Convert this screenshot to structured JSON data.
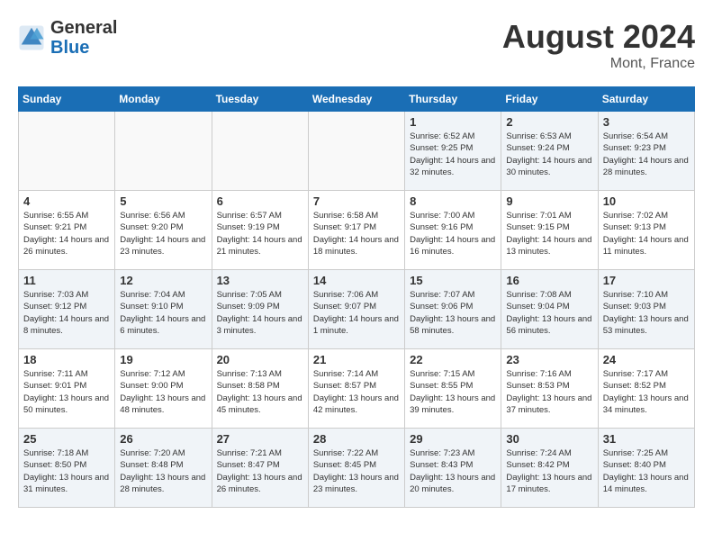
{
  "header": {
    "logo_line1": "General",
    "logo_line2": "Blue",
    "month_year": "August 2024",
    "location": "Mont, France"
  },
  "days_of_week": [
    "Sunday",
    "Monday",
    "Tuesday",
    "Wednesday",
    "Thursday",
    "Friday",
    "Saturday"
  ],
  "weeks": [
    [
      {
        "day": "",
        "empty": true
      },
      {
        "day": "",
        "empty": true
      },
      {
        "day": "",
        "empty": true
      },
      {
        "day": "",
        "empty": true
      },
      {
        "day": "1",
        "sunrise": "6:52 AM",
        "sunset": "9:25 PM",
        "daylight": "14 hours and 32 minutes."
      },
      {
        "day": "2",
        "sunrise": "6:53 AM",
        "sunset": "9:24 PM",
        "daylight": "14 hours and 30 minutes."
      },
      {
        "day": "3",
        "sunrise": "6:54 AM",
        "sunset": "9:23 PM",
        "daylight": "14 hours and 28 minutes."
      }
    ],
    [
      {
        "day": "4",
        "sunrise": "6:55 AM",
        "sunset": "9:21 PM",
        "daylight": "14 hours and 26 minutes."
      },
      {
        "day": "5",
        "sunrise": "6:56 AM",
        "sunset": "9:20 PM",
        "daylight": "14 hours and 23 minutes."
      },
      {
        "day": "6",
        "sunrise": "6:57 AM",
        "sunset": "9:19 PM",
        "daylight": "14 hours and 21 minutes."
      },
      {
        "day": "7",
        "sunrise": "6:58 AM",
        "sunset": "9:17 PM",
        "daylight": "14 hours and 18 minutes."
      },
      {
        "day": "8",
        "sunrise": "7:00 AM",
        "sunset": "9:16 PM",
        "daylight": "14 hours and 16 minutes."
      },
      {
        "day": "9",
        "sunrise": "7:01 AM",
        "sunset": "9:15 PM",
        "daylight": "14 hours and 13 minutes."
      },
      {
        "day": "10",
        "sunrise": "7:02 AM",
        "sunset": "9:13 PM",
        "daylight": "14 hours and 11 minutes."
      }
    ],
    [
      {
        "day": "11",
        "sunrise": "7:03 AM",
        "sunset": "9:12 PM",
        "daylight": "14 hours and 8 minutes."
      },
      {
        "day": "12",
        "sunrise": "7:04 AM",
        "sunset": "9:10 PM",
        "daylight": "14 hours and 6 minutes."
      },
      {
        "day": "13",
        "sunrise": "7:05 AM",
        "sunset": "9:09 PM",
        "daylight": "14 hours and 3 minutes."
      },
      {
        "day": "14",
        "sunrise": "7:06 AM",
        "sunset": "9:07 PM",
        "daylight": "14 hours and 1 minute."
      },
      {
        "day": "15",
        "sunrise": "7:07 AM",
        "sunset": "9:06 PM",
        "daylight": "13 hours and 58 minutes."
      },
      {
        "day": "16",
        "sunrise": "7:08 AM",
        "sunset": "9:04 PM",
        "daylight": "13 hours and 56 minutes."
      },
      {
        "day": "17",
        "sunrise": "7:10 AM",
        "sunset": "9:03 PM",
        "daylight": "13 hours and 53 minutes."
      }
    ],
    [
      {
        "day": "18",
        "sunrise": "7:11 AM",
        "sunset": "9:01 PM",
        "daylight": "13 hours and 50 minutes."
      },
      {
        "day": "19",
        "sunrise": "7:12 AM",
        "sunset": "9:00 PM",
        "daylight": "13 hours and 48 minutes."
      },
      {
        "day": "20",
        "sunrise": "7:13 AM",
        "sunset": "8:58 PM",
        "daylight": "13 hours and 45 minutes."
      },
      {
        "day": "21",
        "sunrise": "7:14 AM",
        "sunset": "8:57 PM",
        "daylight": "13 hours and 42 minutes."
      },
      {
        "day": "22",
        "sunrise": "7:15 AM",
        "sunset": "8:55 PM",
        "daylight": "13 hours and 39 minutes."
      },
      {
        "day": "23",
        "sunrise": "7:16 AM",
        "sunset": "8:53 PM",
        "daylight": "13 hours and 37 minutes."
      },
      {
        "day": "24",
        "sunrise": "7:17 AM",
        "sunset": "8:52 PM",
        "daylight": "13 hours and 34 minutes."
      }
    ],
    [
      {
        "day": "25",
        "sunrise": "7:18 AM",
        "sunset": "8:50 PM",
        "daylight": "13 hours and 31 minutes."
      },
      {
        "day": "26",
        "sunrise": "7:20 AM",
        "sunset": "8:48 PM",
        "daylight": "13 hours and 28 minutes."
      },
      {
        "day": "27",
        "sunrise": "7:21 AM",
        "sunset": "8:47 PM",
        "daylight": "13 hours and 26 minutes."
      },
      {
        "day": "28",
        "sunrise": "7:22 AM",
        "sunset": "8:45 PM",
        "daylight": "13 hours and 23 minutes."
      },
      {
        "day": "29",
        "sunrise": "7:23 AM",
        "sunset": "8:43 PM",
        "daylight": "13 hours and 20 minutes."
      },
      {
        "day": "30",
        "sunrise": "7:24 AM",
        "sunset": "8:42 PM",
        "daylight": "13 hours and 17 minutes."
      },
      {
        "day": "31",
        "sunrise": "7:25 AM",
        "sunset": "8:40 PM",
        "daylight": "13 hours and 14 minutes."
      }
    ]
  ]
}
